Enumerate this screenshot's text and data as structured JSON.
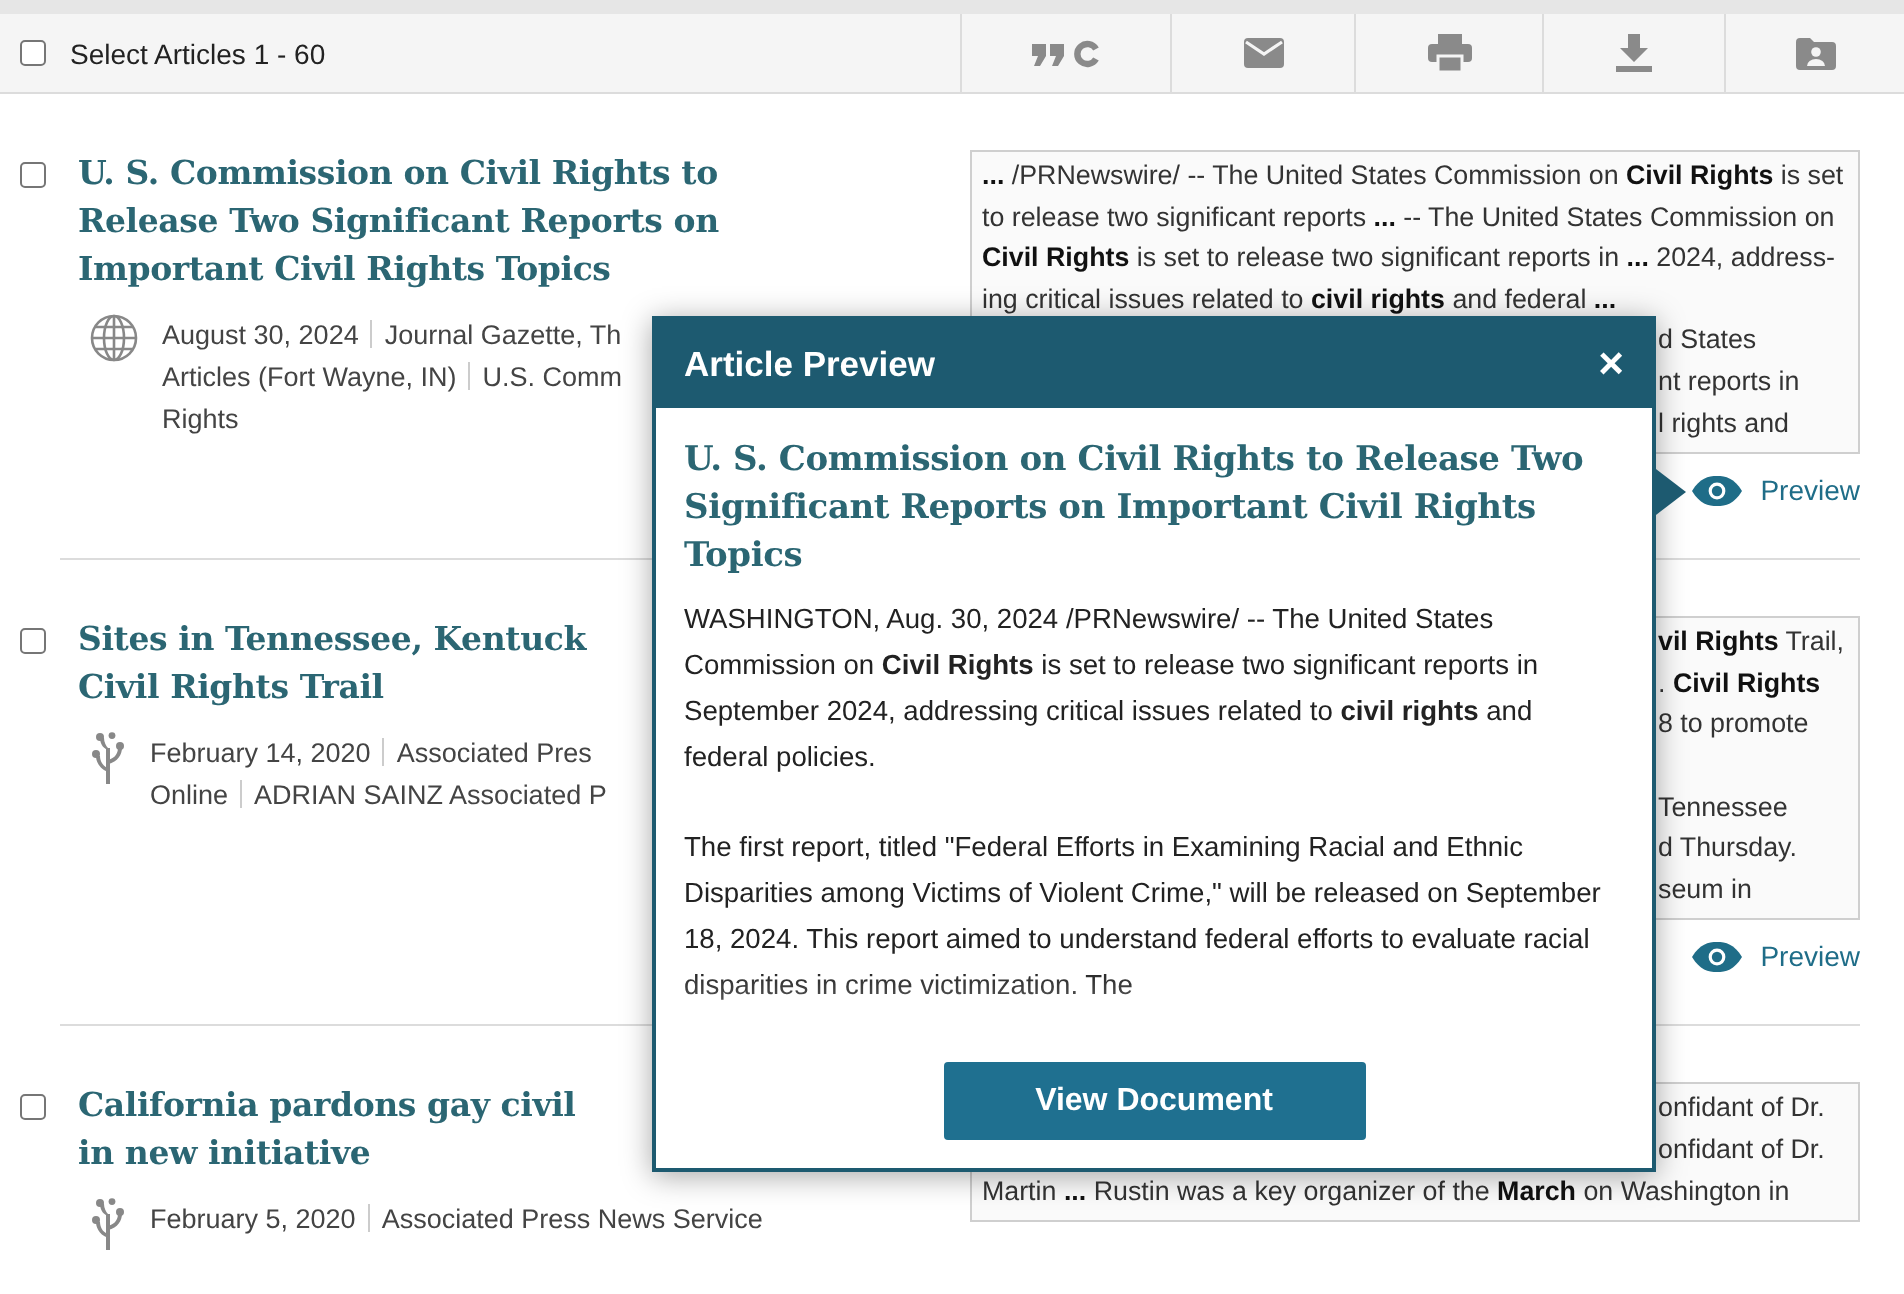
{
  "toolbar": {
    "select_all": {
      "label": "Select Articles 1 - 60",
      "checked": false
    },
    "actions": [
      {
        "kind": "cite"
      },
      {
        "kind": "email"
      },
      {
        "kind": "print"
      },
      {
        "kind": "download"
      },
      {
        "kind": "save"
      }
    ]
  },
  "results": [
    {
      "checked": false,
      "title_lines": [
        "U. S. Commission on Civil Rights to",
        "Release Two Significant Reports on",
        "Important Civil Rights Topics"
      ],
      "kind": "web",
      "meta_lines": [
        [
          "August 30, 2024",
          "Journal Gazette, Th"
        ],
        [
          "Articles (Fort Wayne, IN)",
          "U.S. Comm"
        ],
        [
          "Rights"
        ]
      ],
      "snippet": [
        {
          "lines": [
            {
              "kind": "full",
              "text": "**...** /PRNewswire/ -- The United States Commission on **Civil Rights** is set"
            },
            {
              "kind": "full",
              "text": "to release two significant reports **...** -- The United States Commission on"
            },
            {
              "kind": "full",
              "text": "**Civil Rights** is set to release two significant reports in **...** 2024, address-"
            },
            {
              "kind": "full",
              "text": "ing critical issues related to **civil rights** and federal **...**"
            },
            {
              "kind": "fragment",
              "text": "d States"
            },
            {
              "kind": "fragment",
              "text": "nt reports in"
            },
            {
              "kind": "fragment",
              "text": "l rights and"
            }
          ]
        }
      ],
      "preview_label": "Preview"
    },
    {
      "checked": false,
      "title_lines": [
        "Sites in Tennessee, Kentuck",
        "Civil Rights Trail"
      ],
      "kind": "wire",
      "meta_lines": [
        [
          "February 14, 2020",
          "Associated Pres"
        ],
        [
          "Online",
          "ADRIAN SAINZ Associated P"
        ]
      ],
      "snippet": [
        {
          "lines": [
            {
              "kind": "fragment",
              "text": "**vil Rights** Trail,"
            },
            {
              "kind": "fragment",
              "text": ". **Civil Rights**"
            },
            {
              "kind": "fragment",
              "text": "8 to promote"
            }
          ]
        },
        {
          "lines": [
            {
              "kind": "fragment",
              "text": "Tennessee"
            },
            {
              "kind": "fragment",
              "text": "d Thursday."
            },
            {
              "kind": "fragment",
              "text": "seum in"
            }
          ]
        }
      ],
      "preview_label": "Preview"
    },
    {
      "checked": false,
      "title_lines": [
        "California pardons gay civil",
        "in new initiative"
      ],
      "kind": "wire",
      "meta_lines": [
        [
          "February 5, 2020",
          "Associated Press News Service"
        ]
      ],
      "snippet": [
        {
          "lines": [
            {
              "kind": "fragment",
              "text": "onfidant of Dr."
            },
            {
              "kind": "fragment",
              "text": "onfidant of Dr."
            },
            {
              "kind": "full",
              "text": "Martin **...** Rustin was a key organizer of the **March** on Washington in"
            }
          ]
        }
      ]
    }
  ],
  "preview": {
    "header": "Article Preview",
    "close_label": "×",
    "title": "U. S. Commission on Civil Rights to Release Two Significant Reports on Important Civil Rights Topics",
    "paragraphs": [
      "WASHINGTON, Aug. 30, 2024 /PRNewswire/ -- The United States Commission on **Civil Rights** is set to release two significant reports in September 2024, addressing critical issues related to **civil rights** and federal policies.",
      "The first report, titled \"Federal Efforts in Examining Racial and Ethnic Disparities among Victims of Violent Crime,\" will be released on September 18, 2024. This report aimed to understand federal efforts to evaluate racial disparities in crime victimization. The"
    ],
    "button": "View Document"
  }
}
